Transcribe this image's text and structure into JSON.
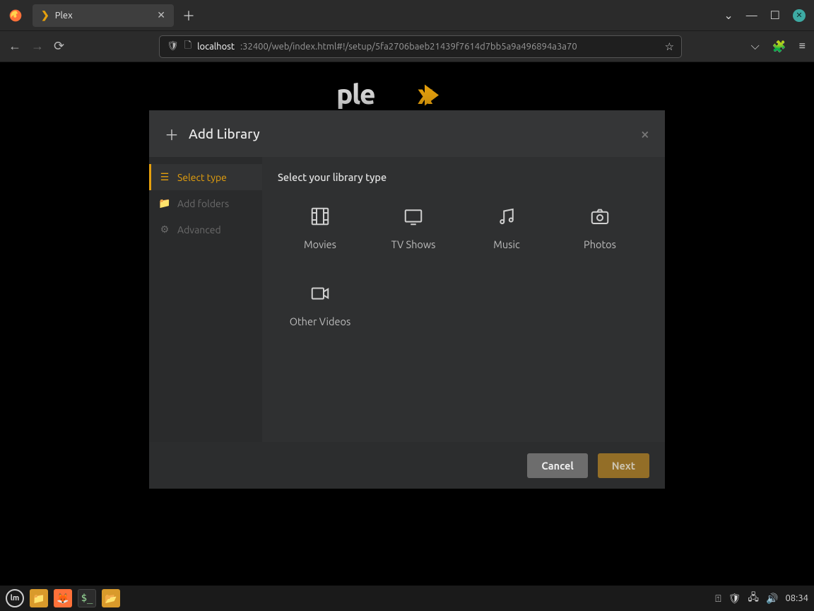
{
  "window": {
    "tab_title": "Plex",
    "url_host": "localhost",
    "url_port_path": ":32400/web/index.html#!/setup/5fa2706baeb21439f7614d7bb5a9a496894a3a70"
  },
  "modal": {
    "title": "Add Library",
    "heading": "Select your library type",
    "steps": [
      {
        "key": "select_type",
        "label": "Select type",
        "active": true
      },
      {
        "key": "add_folders",
        "label": "Add folders",
        "active": false
      },
      {
        "key": "advanced",
        "label": "Advanced",
        "active": false
      }
    ],
    "types": [
      {
        "key": "movies",
        "label": "Movies"
      },
      {
        "key": "tv_shows",
        "label": "TV Shows"
      },
      {
        "key": "music",
        "label": "Music"
      },
      {
        "key": "photos",
        "label": "Photos"
      },
      {
        "key": "other_videos",
        "label": "Other Videos"
      }
    ],
    "buttons": {
      "cancel": "Cancel",
      "next": "Next"
    }
  },
  "clock": "08:34"
}
